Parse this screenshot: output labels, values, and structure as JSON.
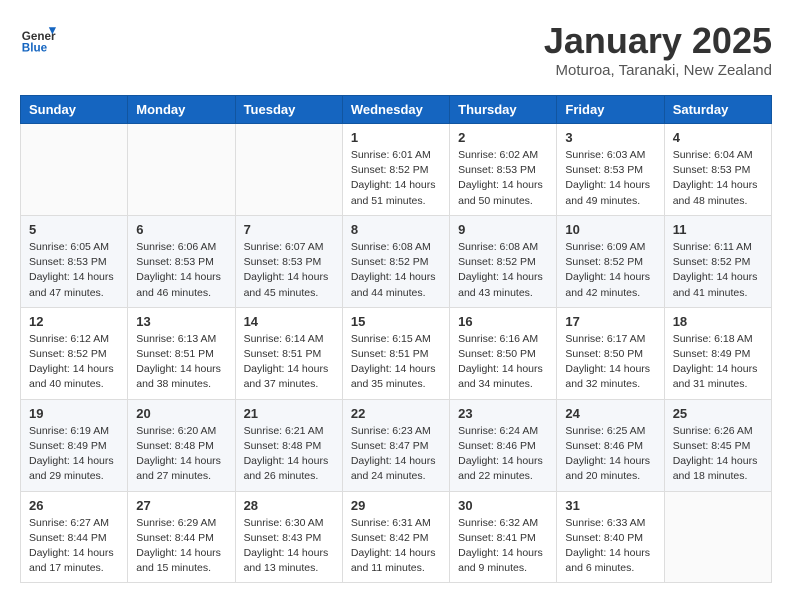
{
  "header": {
    "logo_general": "General",
    "logo_blue": "Blue",
    "month_title": "January 2025",
    "location": "Moturoa, Taranaki, New Zealand"
  },
  "days_of_week": [
    "Sunday",
    "Monday",
    "Tuesday",
    "Wednesday",
    "Thursday",
    "Friday",
    "Saturday"
  ],
  "weeks": [
    {
      "cells": [
        {
          "day": "",
          "sunrise": "",
          "sunset": "",
          "daylight": ""
        },
        {
          "day": "",
          "sunrise": "",
          "sunset": "",
          "daylight": ""
        },
        {
          "day": "",
          "sunrise": "",
          "sunset": "",
          "daylight": ""
        },
        {
          "day": "1",
          "sunrise": "Sunrise: 6:01 AM",
          "sunset": "Sunset: 8:52 PM",
          "daylight": "Daylight: 14 hours and 51 minutes."
        },
        {
          "day": "2",
          "sunrise": "Sunrise: 6:02 AM",
          "sunset": "Sunset: 8:53 PM",
          "daylight": "Daylight: 14 hours and 50 minutes."
        },
        {
          "day": "3",
          "sunrise": "Sunrise: 6:03 AM",
          "sunset": "Sunset: 8:53 PM",
          "daylight": "Daylight: 14 hours and 49 minutes."
        },
        {
          "day": "4",
          "sunrise": "Sunrise: 6:04 AM",
          "sunset": "Sunset: 8:53 PM",
          "daylight": "Daylight: 14 hours and 48 minutes."
        }
      ]
    },
    {
      "cells": [
        {
          "day": "5",
          "sunrise": "Sunrise: 6:05 AM",
          "sunset": "Sunset: 8:53 PM",
          "daylight": "Daylight: 14 hours and 47 minutes."
        },
        {
          "day": "6",
          "sunrise": "Sunrise: 6:06 AM",
          "sunset": "Sunset: 8:53 PM",
          "daylight": "Daylight: 14 hours and 46 minutes."
        },
        {
          "day": "7",
          "sunrise": "Sunrise: 6:07 AM",
          "sunset": "Sunset: 8:53 PM",
          "daylight": "Daylight: 14 hours and 45 minutes."
        },
        {
          "day": "8",
          "sunrise": "Sunrise: 6:08 AM",
          "sunset": "Sunset: 8:52 PM",
          "daylight": "Daylight: 14 hours and 44 minutes."
        },
        {
          "day": "9",
          "sunrise": "Sunrise: 6:08 AM",
          "sunset": "Sunset: 8:52 PM",
          "daylight": "Daylight: 14 hours and 43 minutes."
        },
        {
          "day": "10",
          "sunrise": "Sunrise: 6:09 AM",
          "sunset": "Sunset: 8:52 PM",
          "daylight": "Daylight: 14 hours and 42 minutes."
        },
        {
          "day": "11",
          "sunrise": "Sunrise: 6:11 AM",
          "sunset": "Sunset: 8:52 PM",
          "daylight": "Daylight: 14 hours and 41 minutes."
        }
      ]
    },
    {
      "cells": [
        {
          "day": "12",
          "sunrise": "Sunrise: 6:12 AM",
          "sunset": "Sunset: 8:52 PM",
          "daylight": "Daylight: 14 hours and 40 minutes."
        },
        {
          "day": "13",
          "sunrise": "Sunrise: 6:13 AM",
          "sunset": "Sunset: 8:51 PM",
          "daylight": "Daylight: 14 hours and 38 minutes."
        },
        {
          "day": "14",
          "sunrise": "Sunrise: 6:14 AM",
          "sunset": "Sunset: 8:51 PM",
          "daylight": "Daylight: 14 hours and 37 minutes."
        },
        {
          "day": "15",
          "sunrise": "Sunrise: 6:15 AM",
          "sunset": "Sunset: 8:51 PM",
          "daylight": "Daylight: 14 hours and 35 minutes."
        },
        {
          "day": "16",
          "sunrise": "Sunrise: 6:16 AM",
          "sunset": "Sunset: 8:50 PM",
          "daylight": "Daylight: 14 hours and 34 minutes."
        },
        {
          "day": "17",
          "sunrise": "Sunrise: 6:17 AM",
          "sunset": "Sunset: 8:50 PM",
          "daylight": "Daylight: 14 hours and 32 minutes."
        },
        {
          "day": "18",
          "sunrise": "Sunrise: 6:18 AM",
          "sunset": "Sunset: 8:49 PM",
          "daylight": "Daylight: 14 hours and 31 minutes."
        }
      ]
    },
    {
      "cells": [
        {
          "day": "19",
          "sunrise": "Sunrise: 6:19 AM",
          "sunset": "Sunset: 8:49 PM",
          "daylight": "Daylight: 14 hours and 29 minutes."
        },
        {
          "day": "20",
          "sunrise": "Sunrise: 6:20 AM",
          "sunset": "Sunset: 8:48 PM",
          "daylight": "Daylight: 14 hours and 27 minutes."
        },
        {
          "day": "21",
          "sunrise": "Sunrise: 6:21 AM",
          "sunset": "Sunset: 8:48 PM",
          "daylight": "Daylight: 14 hours and 26 minutes."
        },
        {
          "day": "22",
          "sunrise": "Sunrise: 6:23 AM",
          "sunset": "Sunset: 8:47 PM",
          "daylight": "Daylight: 14 hours and 24 minutes."
        },
        {
          "day": "23",
          "sunrise": "Sunrise: 6:24 AM",
          "sunset": "Sunset: 8:46 PM",
          "daylight": "Daylight: 14 hours and 22 minutes."
        },
        {
          "day": "24",
          "sunrise": "Sunrise: 6:25 AM",
          "sunset": "Sunset: 8:46 PM",
          "daylight": "Daylight: 14 hours and 20 minutes."
        },
        {
          "day": "25",
          "sunrise": "Sunrise: 6:26 AM",
          "sunset": "Sunset: 8:45 PM",
          "daylight": "Daylight: 14 hours and 18 minutes."
        }
      ]
    },
    {
      "cells": [
        {
          "day": "26",
          "sunrise": "Sunrise: 6:27 AM",
          "sunset": "Sunset: 8:44 PM",
          "daylight": "Daylight: 14 hours and 17 minutes."
        },
        {
          "day": "27",
          "sunrise": "Sunrise: 6:29 AM",
          "sunset": "Sunset: 8:44 PM",
          "daylight": "Daylight: 14 hours and 15 minutes."
        },
        {
          "day": "28",
          "sunrise": "Sunrise: 6:30 AM",
          "sunset": "Sunset: 8:43 PM",
          "daylight": "Daylight: 14 hours and 13 minutes."
        },
        {
          "day": "29",
          "sunrise": "Sunrise: 6:31 AM",
          "sunset": "Sunset: 8:42 PM",
          "daylight": "Daylight: 14 hours and 11 minutes."
        },
        {
          "day": "30",
          "sunrise": "Sunrise: 6:32 AM",
          "sunset": "Sunset: 8:41 PM",
          "daylight": "Daylight: 14 hours and 9 minutes."
        },
        {
          "day": "31",
          "sunrise": "Sunrise: 6:33 AM",
          "sunset": "Sunset: 8:40 PM",
          "daylight": "Daylight: 14 hours and 6 minutes."
        },
        {
          "day": "",
          "sunrise": "",
          "sunset": "",
          "daylight": ""
        }
      ]
    }
  ]
}
